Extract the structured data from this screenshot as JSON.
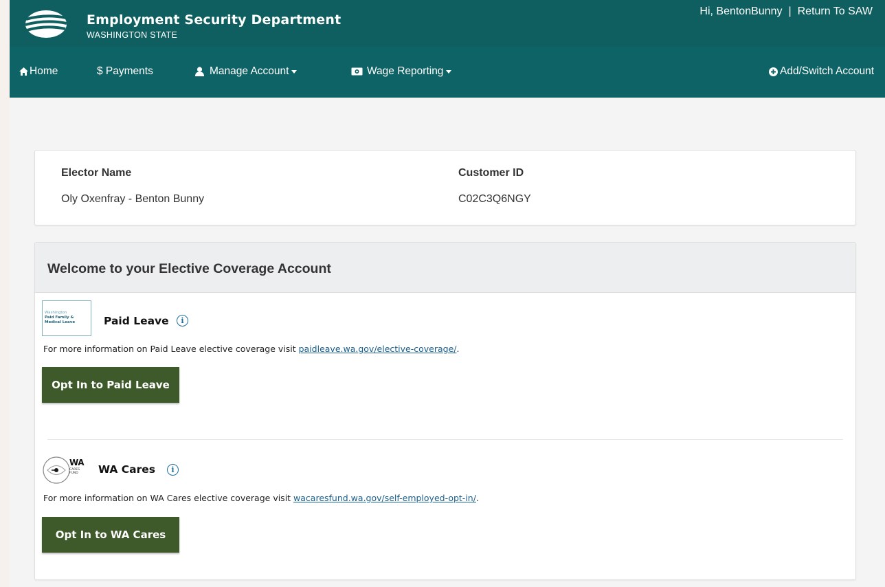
{
  "header": {
    "title": "Employment Security Department",
    "subtitle": "WASHINGTON STATE",
    "greeting": "Hi, BentonBunny",
    "separator": "|",
    "return_link": "Return To SAW"
  },
  "nav": {
    "home": "Home",
    "payments": "$ Payments",
    "manage_account": "Manage Account",
    "wage_reporting": "Wage Reporting",
    "add_switch": "Add/Switch Account"
  },
  "elector": {
    "name_label": "Elector Name",
    "name_value": "Oly Oxenfray - Benton Bunny",
    "id_label": "Customer ID",
    "id_value": "C02C3Q6NGY"
  },
  "panel": {
    "title": "Welcome to your Elective Coverage Account"
  },
  "paid_leave": {
    "logo_text_line1": "Washington",
    "logo_text_line2": "Paid Family &",
    "logo_text_line3": "Medical Leave",
    "name": "Paid Leave",
    "desc_prefix": "For more information on Paid Leave elective coverage visit ",
    "link": "paidleave.wa.gov/elective-coverage/",
    "desc_suffix": ".",
    "button": "Opt In to Paid Leave"
  },
  "wa_cares": {
    "logo_text": "WA",
    "logo_sub": "CARES FUND",
    "name": "WA Cares",
    "desc_prefix": "For more information on WA Cares elective coverage visit ",
    "link": "wacaresfund.wa.gov/self-employed-opt-in/",
    "desc_suffix": ".",
    "button": "Opt In to WA Cares"
  },
  "icons": {
    "home": "home-icon",
    "user": "user-icon",
    "money": "money-icon",
    "plus": "plus-circle-icon",
    "info": "info-icon"
  },
  "colors": {
    "header": "#0f5f61",
    "button": "#3e5a2a",
    "link": "#1a5f8b"
  }
}
